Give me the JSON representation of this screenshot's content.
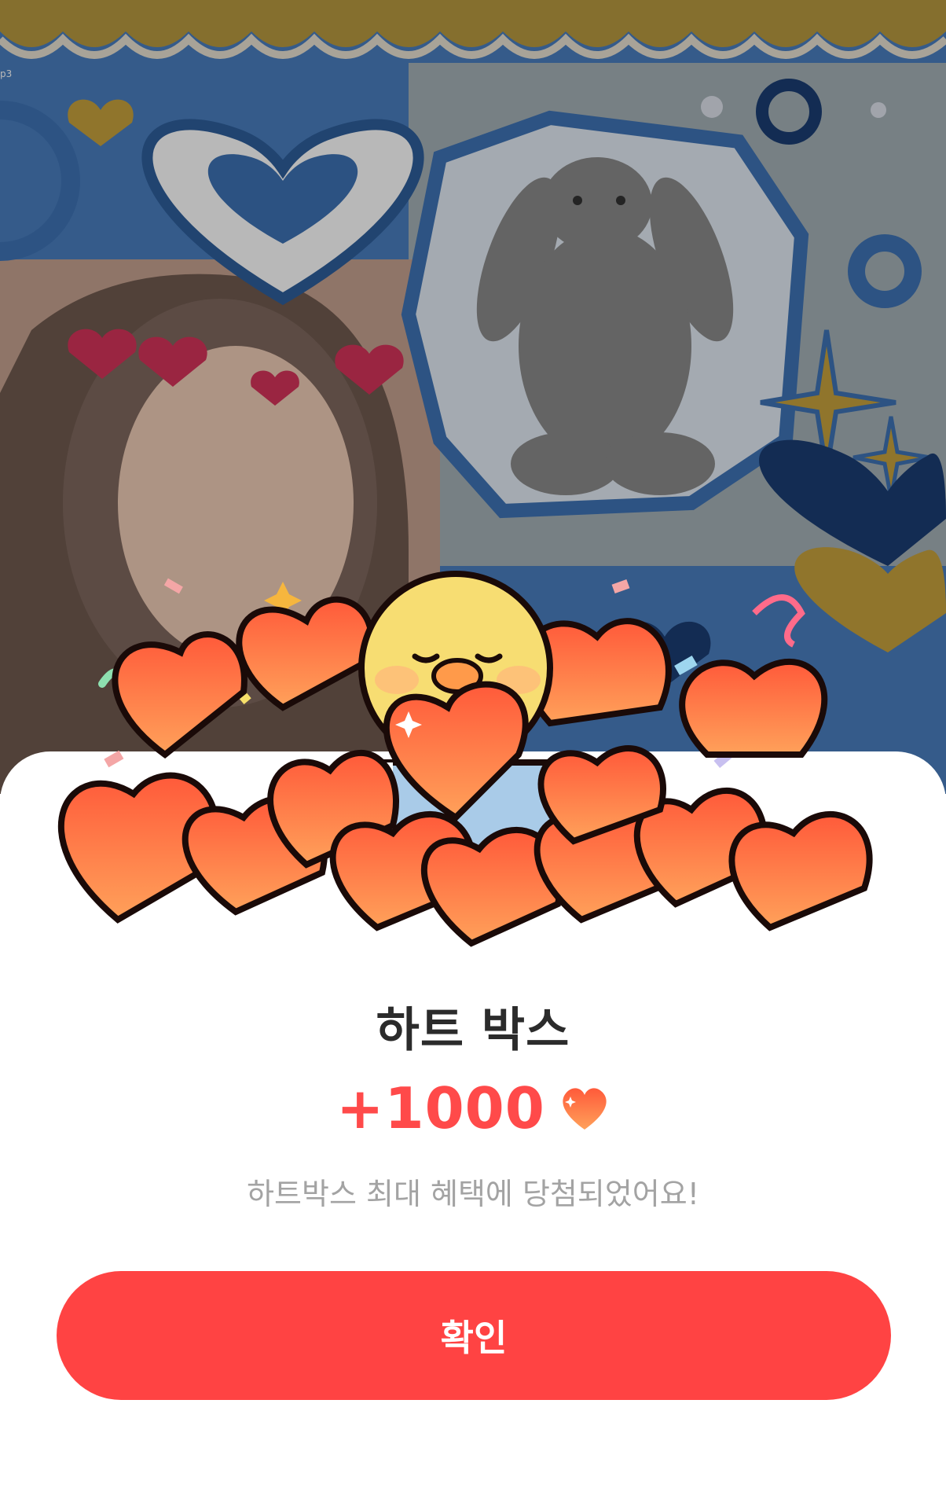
{
  "background": {
    "corner_label": "p3",
    "colors": {
      "scallop": "#b99a41",
      "blue": "#3f74b6",
      "dark_blue": "#1b3e74",
      "gold": "#c8a23e",
      "dim_overlay": "rgba(0,0,0,0.28)"
    }
  },
  "popup": {
    "title": "하트 박스",
    "reward_amount": "+1000",
    "reward_icon": "heart-icon",
    "message": "하트박스 최대 혜택에 당첨되었어요!",
    "confirm_label": "확인",
    "colors": {
      "accent": "#ff4343",
      "title": "#2b2b2b",
      "message": "#a3a3a3",
      "heart_top": "#ff5a3a",
      "heart_bottom": "#ffa15a"
    }
  }
}
